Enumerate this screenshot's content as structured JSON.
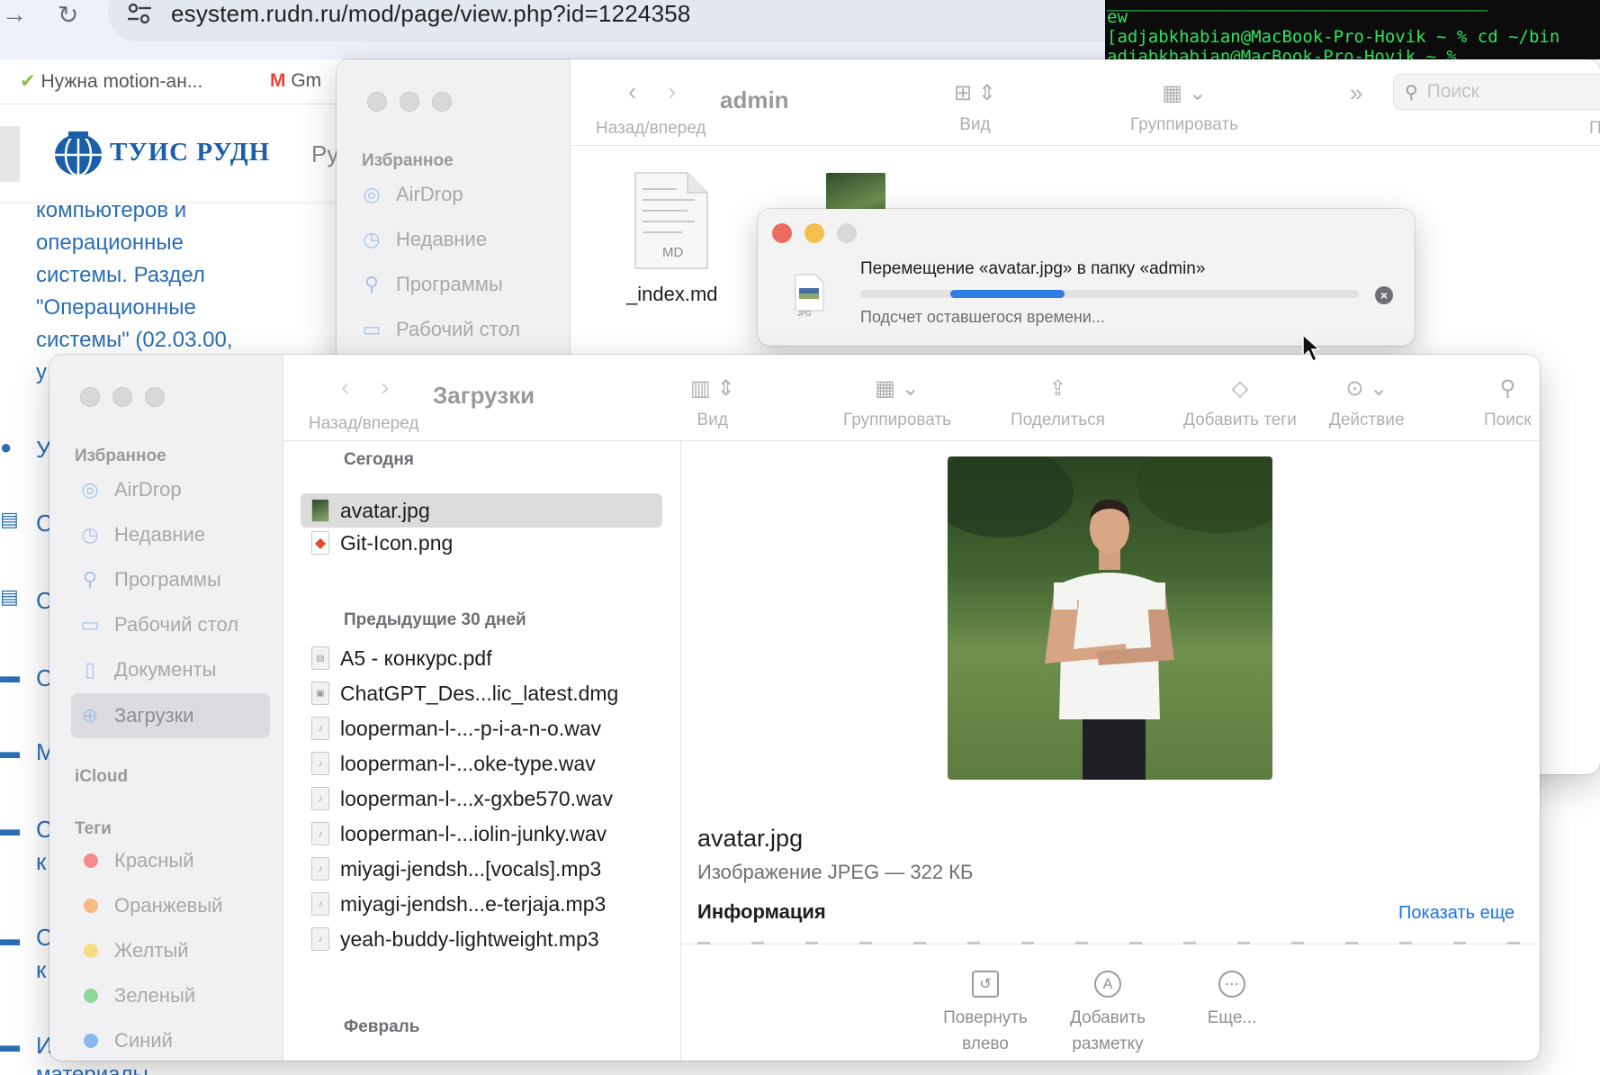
{
  "browser": {
    "url": "esystem.rudn.ru/mod/page/view.php?id=1224358",
    "bookmarks": [
      "Нужна motion-ан...",
      "Gm"
    ],
    "site_name": "ТУИС РУДН",
    "site_nav_fragment": "Ру",
    "page_lines": [
      "компьютеров и",
      "операционные",
      "системы. Раздел",
      "\"Операционные",
      "системы\" (02.03.00,",
      "у"
    ],
    "left_letters": [
      "У",
      "С",
      "С",
      "С",
      "М",
      "С",
      "к",
      "С",
      "к",
      "И"
    ],
    "bottom_fragment": "материалы"
  },
  "terminal": {
    "lines": [
      "ew",
      "[adjabkhabian@MacBook-Pro-Hovik ~ % cd ~/bin",
      "adjabkhabian@MacBook-Pro-Hovik ~ % "
    ]
  },
  "finder_back": {
    "title": "admin",
    "nav_label": "Назад/вперед",
    "view_label": "Вид",
    "group_label": "Группировать",
    "search_placeholder": "Поиск",
    "truncated_label": "П",
    "sidebar_section": "Избранное",
    "sidebar_items": [
      "AirDrop",
      "Недавние",
      "Программы",
      "Рабочий стол"
    ],
    "files": [
      {
        "name": "_index.md",
        "badge": "MD"
      }
    ]
  },
  "dialog": {
    "title": "Перемещение «avatar.jpg» в папку «admin»",
    "status": "Подсчет оставшегося времени...",
    "progress": 0.23,
    "file_badge": "JPG"
  },
  "finder_front": {
    "title": "Загрузки",
    "nav_label": "Назад/вперед",
    "toolbar": [
      "Вид",
      "Группировать",
      "Поделиться",
      "Добавить теги",
      "Действие",
      "Поиск"
    ],
    "sidebar_favorites_label": "Избранное",
    "sidebar_items": [
      "AirDrop",
      "Недавние",
      "Программы",
      "Рабочий стол",
      "Документы",
      "Загрузки"
    ],
    "sidebar_active": "Загрузки",
    "icloud_label": "iCloud",
    "tags_label": "Теги",
    "tags": [
      {
        "name": "Красный",
        "color": "#f48a8a"
      },
      {
        "name": "Оранжевый",
        "color": "#f5bb80"
      },
      {
        "name": "Желтый",
        "color": "#f6dc82"
      },
      {
        "name": "Зеленый",
        "color": "#8fd89a"
      },
      {
        "name": "Синий",
        "color": "#8ab7ef"
      }
    ],
    "sections": [
      {
        "label": "Сегодня",
        "files": [
          "avatar.jpg",
          "Git-Icon.png"
        ]
      },
      {
        "label": "Предыдущие 30 дней",
        "files": [
          "A5 - конкурс.pdf",
          "ChatGPT_Des...lic_latest.dmg",
          "looperman-l-...-p-i-a-n-o.wav",
          "looperman-l-...oke-type.wav",
          "looperman-l-...x-gxbe570.wav",
          "looperman-l-...iolin-junky.wav",
          "miyagi-jendsh...[vocals].mp3",
          "miyagi-jendsh...e-terjaja.mp3",
          "yeah-buddy-lightweight.mp3"
        ]
      },
      {
        "label": "Февраль",
        "files": []
      }
    ],
    "selected_file": "avatar.jpg",
    "preview": {
      "name": "avatar.jpg",
      "kind": "Изображение JPEG — 322 КБ",
      "info_label": "Информация",
      "more_link": "Показать еще",
      "actions": [
        {
          "line1": "Повернуть",
          "line2": "влево",
          "icon": "rotate-left-icon"
        },
        {
          "line1": "Добавить",
          "line2": "разметку",
          "icon": "markup-icon"
        },
        {
          "line1": "Еще...",
          "line2": "",
          "icon": "more-icon"
        }
      ]
    }
  },
  "colors": {
    "close": "#ed6a5e",
    "minimize": "#f5bf4f",
    "disabled": "#d8d8d8",
    "accent": "#2f7de1",
    "link": "#1a74e8"
  }
}
